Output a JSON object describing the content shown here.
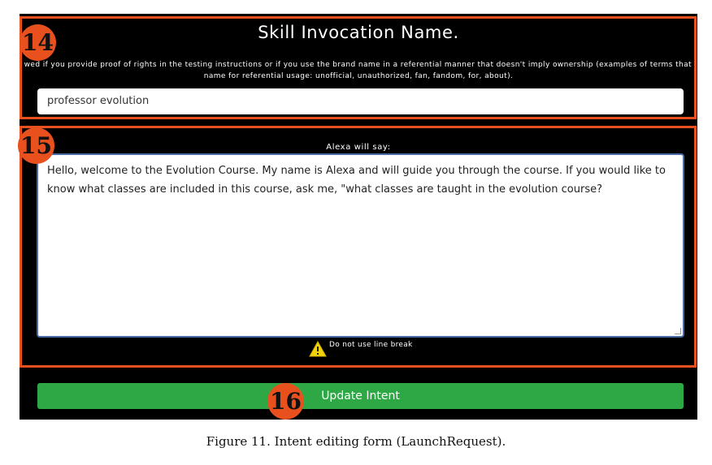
{
  "colors": {
    "panel_bg": "#000000",
    "highlight_border": "#e8501e",
    "badge": "#e8501e",
    "button": "#2ea845",
    "warning": "#f2d30a"
  },
  "invocation": {
    "title": "Skill Invocation Name.",
    "description_line1": "allowed if you provide proof of rights in the testing instructions or if you use the brand name in a referential manner that doesn't imply ownership (examples of terms that are",
    "description_line2": "name for referential usage: unofficial, unauthorized, fan, fandom, for, about).",
    "value": "professor evolution"
  },
  "response": {
    "label": "Alexa will say:",
    "value": "Hello, welcome to the Evolution Course. My name is Alexa and will guide you through the course. If you would like to know what classes are included in this course, ask me, \"what classes are taught in the evolution course?",
    "warning_icon": "warning-icon",
    "warning_text": "Do not use line break"
  },
  "submit": {
    "label": "Update Intent"
  },
  "badges": {
    "b14": "14",
    "b15": "15",
    "b16": "16"
  },
  "caption": "Figure 11. Intent editing form (LaunchRequest)."
}
